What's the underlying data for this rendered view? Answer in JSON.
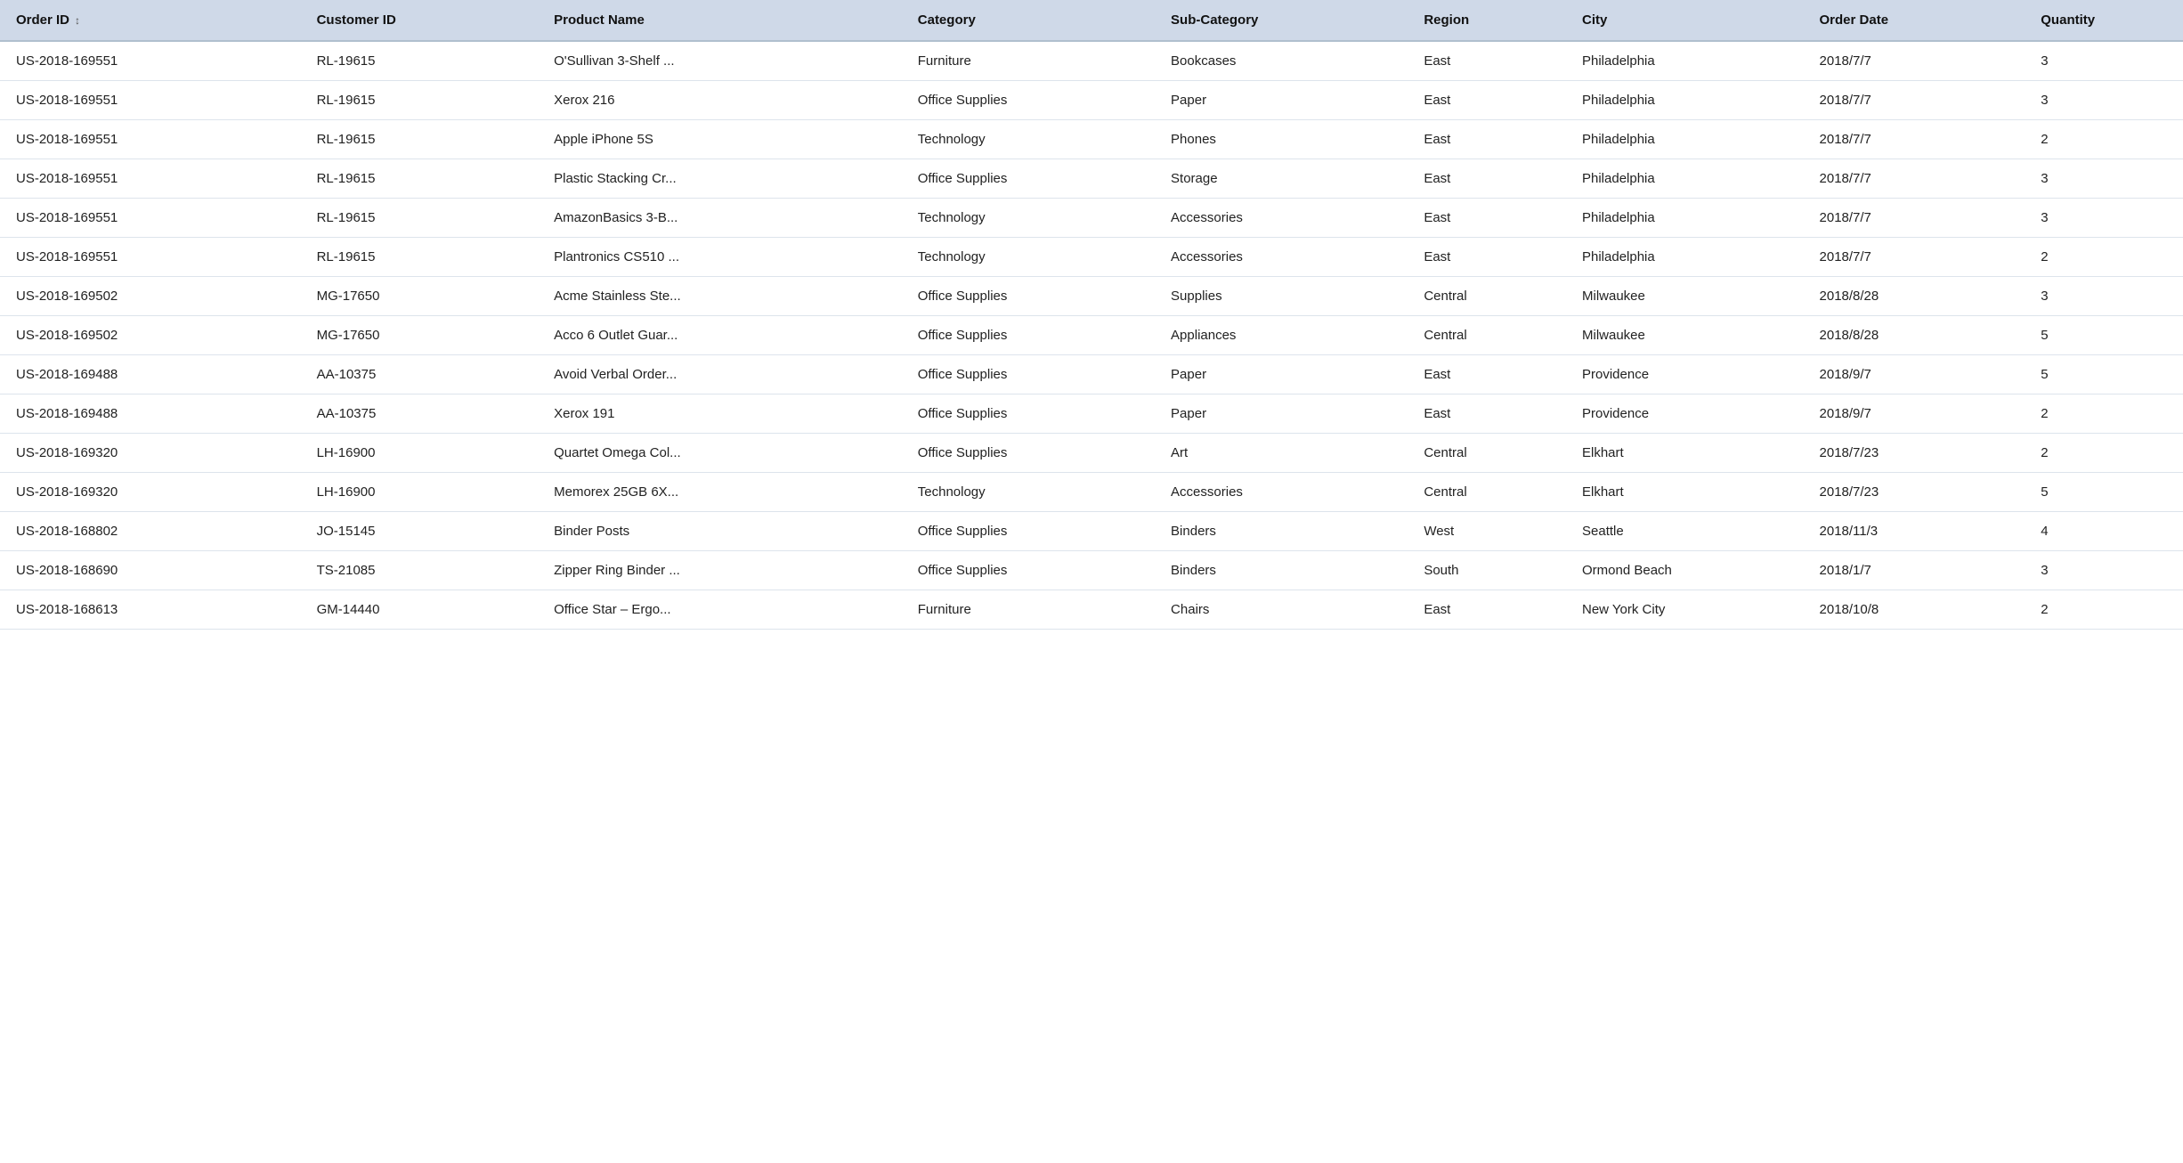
{
  "table": {
    "columns": [
      {
        "key": "order_id",
        "label": "Order ID",
        "sortable": true,
        "class": "order-id-col"
      },
      {
        "key": "customer_id",
        "label": "Customer ID",
        "sortable": false,
        "class": "customer-id-col"
      },
      {
        "key": "product_name",
        "label": "Product Name",
        "sortable": false,
        "class": "product-name-col"
      },
      {
        "key": "category",
        "label": "Category",
        "sortable": false,
        "class": "category-col"
      },
      {
        "key": "sub_category",
        "label": "Sub-Category",
        "sortable": false,
        "class": "subcategory-col"
      },
      {
        "key": "region",
        "label": "Region",
        "sortable": false,
        "class": "region-col"
      },
      {
        "key": "city",
        "label": "City",
        "sortable": false,
        "class": "city-col"
      },
      {
        "key": "order_date",
        "label": "Order Date",
        "sortable": false,
        "class": "order-date-col"
      },
      {
        "key": "quantity",
        "label": "Quantity",
        "sortable": false,
        "class": "quantity-col"
      }
    ],
    "rows": [
      {
        "order_id": "US-2018-169551",
        "customer_id": "RL-19615",
        "product_name": "O'Sullivan 3-Shelf ...",
        "category": "Furniture",
        "sub_category": "Bookcases",
        "region": "East",
        "city": "Philadelphia",
        "order_date": "2018/7/7",
        "quantity": "3"
      },
      {
        "order_id": "US-2018-169551",
        "customer_id": "RL-19615",
        "product_name": "Xerox 216",
        "category": "Office Supplies",
        "sub_category": "Paper",
        "region": "East",
        "city": "Philadelphia",
        "order_date": "2018/7/7",
        "quantity": "3"
      },
      {
        "order_id": "US-2018-169551",
        "customer_id": "RL-19615",
        "product_name": "Apple iPhone 5S",
        "category": "Technology",
        "sub_category": "Phones",
        "region": "East",
        "city": "Philadelphia",
        "order_date": "2018/7/7",
        "quantity": "2"
      },
      {
        "order_id": "US-2018-169551",
        "customer_id": "RL-19615",
        "product_name": "Plastic Stacking Cr...",
        "category": "Office Supplies",
        "sub_category": "Storage",
        "region": "East",
        "city": "Philadelphia",
        "order_date": "2018/7/7",
        "quantity": "3"
      },
      {
        "order_id": "US-2018-169551",
        "customer_id": "RL-19615",
        "product_name": "AmazonBasics 3-B...",
        "category": "Technology",
        "sub_category": "Accessories",
        "region": "East",
        "city": "Philadelphia",
        "order_date": "2018/7/7",
        "quantity": "3"
      },
      {
        "order_id": "US-2018-169551",
        "customer_id": "RL-19615",
        "product_name": "Plantronics CS510 ...",
        "category": "Technology",
        "sub_category": "Accessories",
        "region": "East",
        "city": "Philadelphia",
        "order_date": "2018/7/7",
        "quantity": "2"
      },
      {
        "order_id": "US-2018-169502",
        "customer_id": "MG-17650",
        "product_name": "Acme Stainless Ste...",
        "category": "Office Supplies",
        "sub_category": "Supplies",
        "region": "Central",
        "city": "Milwaukee",
        "order_date": "2018/8/28",
        "quantity": "3"
      },
      {
        "order_id": "US-2018-169502",
        "customer_id": "MG-17650",
        "product_name": "Acco 6 Outlet Guar...",
        "category": "Office Supplies",
        "sub_category": "Appliances",
        "region": "Central",
        "city": "Milwaukee",
        "order_date": "2018/8/28",
        "quantity": "5"
      },
      {
        "order_id": "US-2018-169488",
        "customer_id": "AA-10375",
        "product_name": "Avoid Verbal Order...",
        "category": "Office Supplies",
        "sub_category": "Paper",
        "region": "East",
        "city": "Providence",
        "order_date": "2018/9/7",
        "quantity": "5"
      },
      {
        "order_id": "US-2018-169488",
        "customer_id": "AA-10375",
        "product_name": "Xerox 191",
        "category": "Office Supplies",
        "sub_category": "Paper",
        "region": "East",
        "city": "Providence",
        "order_date": "2018/9/7",
        "quantity": "2"
      },
      {
        "order_id": "US-2018-169320",
        "customer_id": "LH-16900",
        "product_name": "Quartet Omega Col...",
        "category": "Office Supplies",
        "sub_category": "Art",
        "region": "Central",
        "city": "Elkhart",
        "order_date": "2018/7/23",
        "quantity": "2"
      },
      {
        "order_id": "US-2018-169320",
        "customer_id": "LH-16900",
        "product_name": "Memorex 25GB 6X...",
        "category": "Technology",
        "sub_category": "Accessories",
        "region": "Central",
        "city": "Elkhart",
        "order_date": "2018/7/23",
        "quantity": "5"
      },
      {
        "order_id": "US-2018-168802",
        "customer_id": "JO-15145",
        "product_name": "Binder Posts",
        "category": "Office Supplies",
        "sub_category": "Binders",
        "region": "West",
        "city": "Seattle",
        "order_date": "2018/11/3",
        "quantity": "4"
      },
      {
        "order_id": "US-2018-168690",
        "customer_id": "TS-21085",
        "product_name": "Zipper Ring Binder ...",
        "category": "Office Supplies",
        "sub_category": "Binders",
        "region": "South",
        "city": "Ormond Beach",
        "order_date": "2018/1/7",
        "quantity": "3"
      },
      {
        "order_id": "US-2018-168613",
        "customer_id": "GM-14440",
        "product_name": "Office Star – Ergo...",
        "category": "Furniture",
        "sub_category": "Chairs",
        "region": "East",
        "city": "New York City",
        "order_date": "2018/10/8",
        "quantity": "2"
      }
    ]
  }
}
